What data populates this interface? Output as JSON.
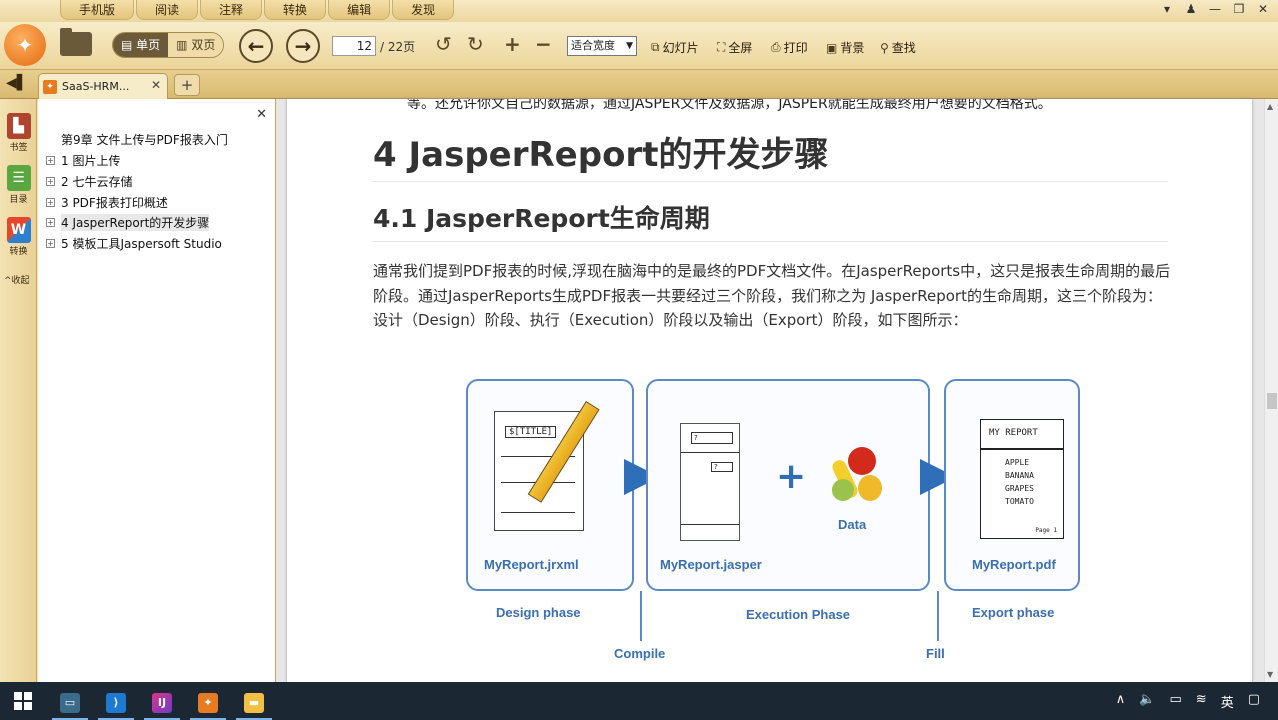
{
  "menu": {
    "tabs": [
      "手机版",
      "阅读",
      "注释",
      "转换",
      "编辑",
      "发现"
    ]
  },
  "window_controls": [
    "▾",
    "♟",
    "—",
    "❐",
    "✕"
  ],
  "toolbar": {
    "single_page": "单页",
    "double_page": "双页",
    "page_current": "12",
    "page_total": "/ 22页",
    "zoom": "适合宽度",
    "slideshow": "幻灯片",
    "fullscreen": "全屏",
    "print": "打印",
    "background": "背景",
    "search": "查找"
  },
  "tabbar": {
    "tab_title": "SaaS-HRM...",
    "close": "✕",
    "add": "+"
  },
  "rail": {
    "bookmark": "书签",
    "outline": "目录",
    "convert": "转换",
    "collapse": "^收起"
  },
  "outline": {
    "close": "✕",
    "root": "第9章 文件上传与PDF报表入门",
    "items": [
      {
        "label": "1 图片上传"
      },
      {
        "label": "2 七牛云存储"
      },
      {
        "label": "3 PDF报表打印概述"
      },
      {
        "label": "4 JasperReport的开发步骤"
      },
      {
        "label": "5 模板工具Jaspersoft Studio"
      }
    ]
  },
  "document": {
    "cut_line": "等。还允许你文自己的数据源，通过JASPER文件及数据源，JASPER就能生成最终用户想要的文档格式。",
    "h1": "4 JasperReport的开发步骤",
    "h2": "4.1 JasperReport生命周期",
    "paragraph": "通常我们提到PDF报表的时候,浮现在脑海中的是最终的PDF文档文件。在JasperReports中，这只是报表生命周期的最后阶段。通过JasperReports生成PDF报表一共要经过三个阶段，我们称之为 JasperReport的生命周期，这三个阶段为：设计（Design）阶段、执行（Execution）阶段以及输出（Export）阶段，如下图所示：",
    "diagram": {
      "sketch_title": "$[TITLE]",
      "file1": "MyReport.jrxml",
      "file2": "MyReport.jasper",
      "file3": "MyReport.pdf",
      "data": "Data",
      "phase1": "Design phase",
      "phase2": "Execution Phase",
      "phase3": "Export phase",
      "compile": "Compile",
      "fill": "Fill",
      "pdf_title": "MY REPORT",
      "pdf_lines": [
        "APPLE",
        "BANANA",
        "GRAPES",
        "TOMATO"
      ],
      "pdf_footer": "Page 1"
    }
  },
  "taskbar": {
    "tray": [
      "∧",
      "🔈",
      "▭",
      "≋",
      "英",
      "▢"
    ]
  },
  "colors": {
    "accent_blue": "#2f6fb8",
    "chrome": "#ecd59b"
  }
}
